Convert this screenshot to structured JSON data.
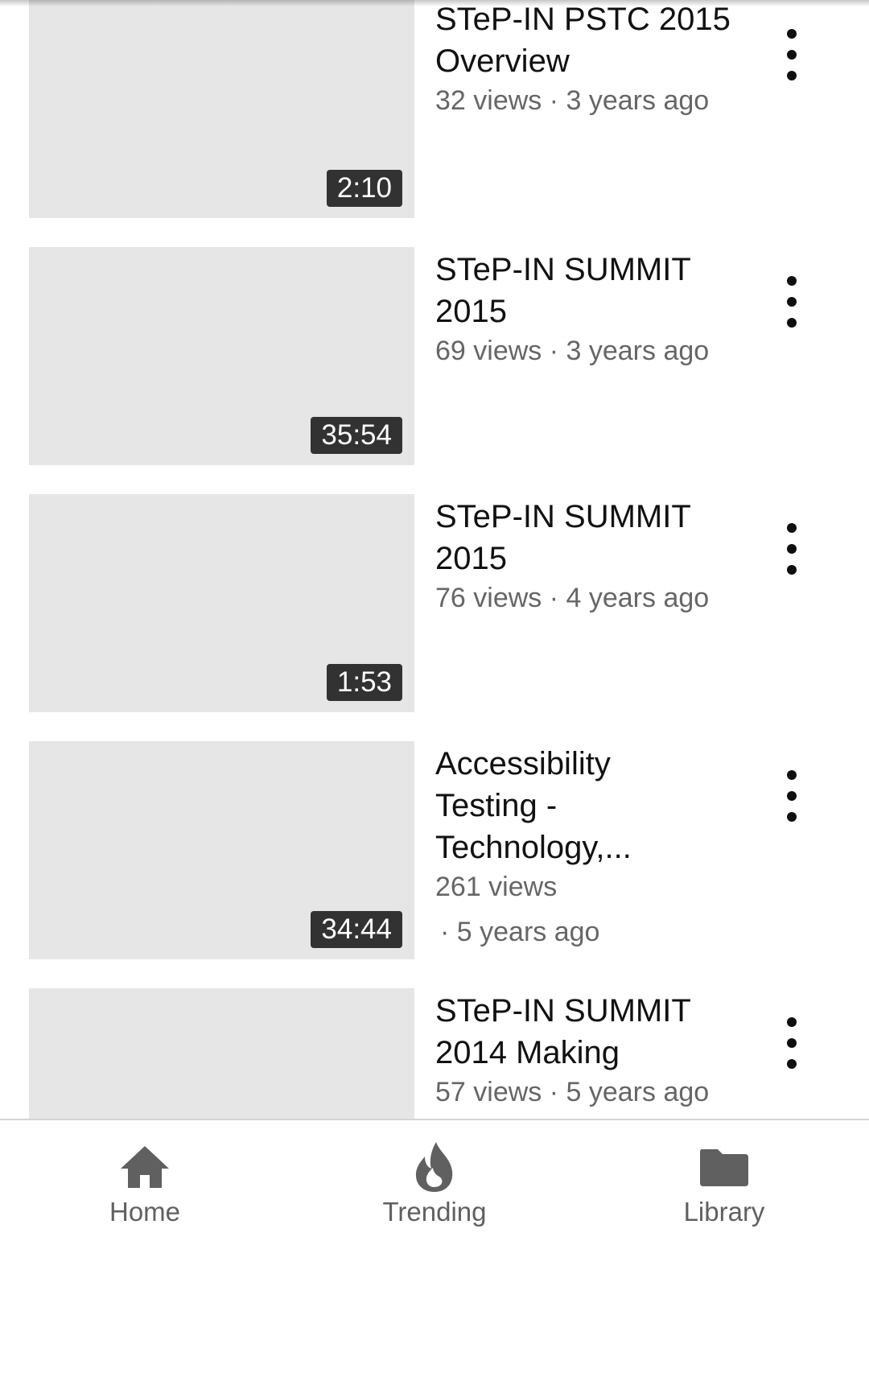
{
  "videos": [
    {
      "title": "STeP-IN PSTC 2015 Overview",
      "meta": "32 views · 3 years ago",
      "duration": "2:10"
    },
    {
      "title": "STeP-IN SUMMIT 2015",
      "meta": "69 views · 3 years ago",
      "duration": "35:54"
    },
    {
      "title": "STeP-IN SUMMIT 2015",
      "meta": "76 views · 4 years ago",
      "duration": "1:53"
    },
    {
      "title": "Accessibility Testing - Technology,...",
      "meta": "261 views",
      "meta2": "· 5 years ago",
      "duration": "34:44"
    },
    {
      "title": "STeP-IN SUMMIT 2014 Making",
      "meta": "57 views · 5 years ago",
      "duration": ""
    }
  ],
  "nav": {
    "home": "Home",
    "trending": "Trending",
    "library": "Library"
  },
  "icons": {
    "more": "more-vert-icon",
    "home": "home-icon",
    "trending": "flame-icon",
    "library": "folder-icon"
  },
  "colors": {
    "thumbnail": "#e6e6e6",
    "duration_bg": "#323232",
    "title": "#111111",
    "meta": "#666666",
    "nav_icon": "#606060"
  }
}
